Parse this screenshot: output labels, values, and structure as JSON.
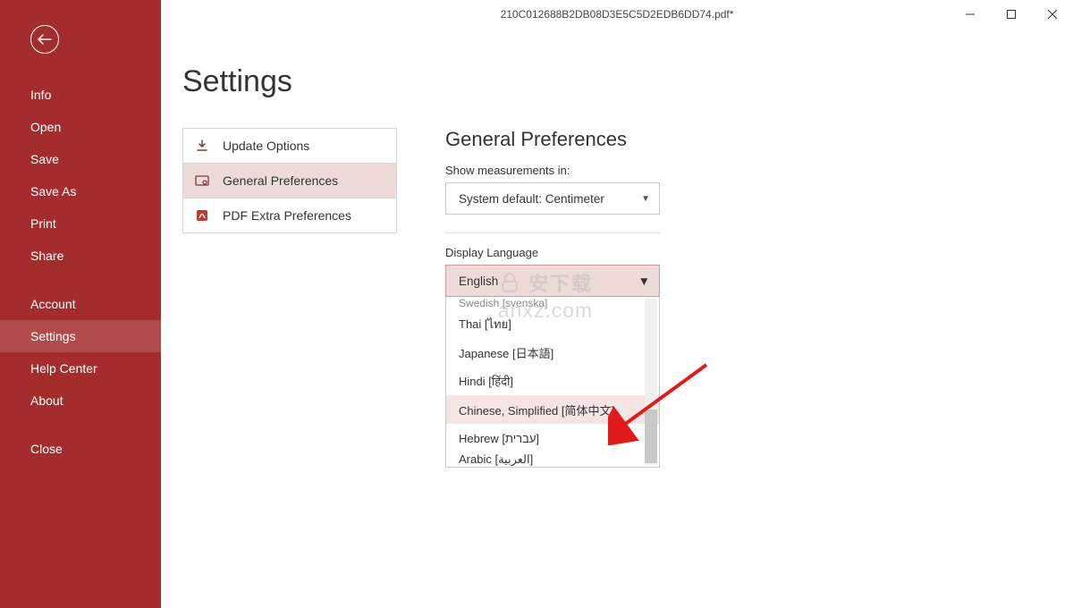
{
  "window": {
    "title": "210C012688B2DB08D3E5C5D2EDB6DD74.pdf*"
  },
  "sidebar": {
    "items": [
      "Info",
      "Open",
      "Save",
      "Save As",
      "Print",
      "Share"
    ],
    "items2": [
      "Account",
      "Settings",
      "Help Center",
      "About"
    ],
    "items3": [
      "Close"
    ],
    "active": "Settings"
  },
  "page": {
    "title": "Settings"
  },
  "nav": {
    "items": [
      {
        "label": "Update Options",
        "icon": "download"
      },
      {
        "label": "General Preferences",
        "icon": "gear",
        "active": true
      },
      {
        "label": "PDF Extra Preferences",
        "icon": "pdf"
      }
    ]
  },
  "prefs": {
    "title": "General Preferences",
    "measure_label": "Show measurements in:",
    "measure_value": "System default: Centimeter",
    "lang_label": "Display Language",
    "lang_value": "English",
    "lang_options_partial_top": "Swedish [svenska]",
    "lang_options": [
      "Thai [ไทย]",
      "Japanese [日本語]",
      "Hindi [हिंदी]",
      "Chinese, Simplified [简体中文]",
      "Hebrew [עברית]"
    ],
    "lang_options_partial_bot": "Arabic [العربية]",
    "lang_highlight_index": 3
  },
  "watermark": {
    "line1": "安下载",
    "line2": "anxz.com"
  }
}
